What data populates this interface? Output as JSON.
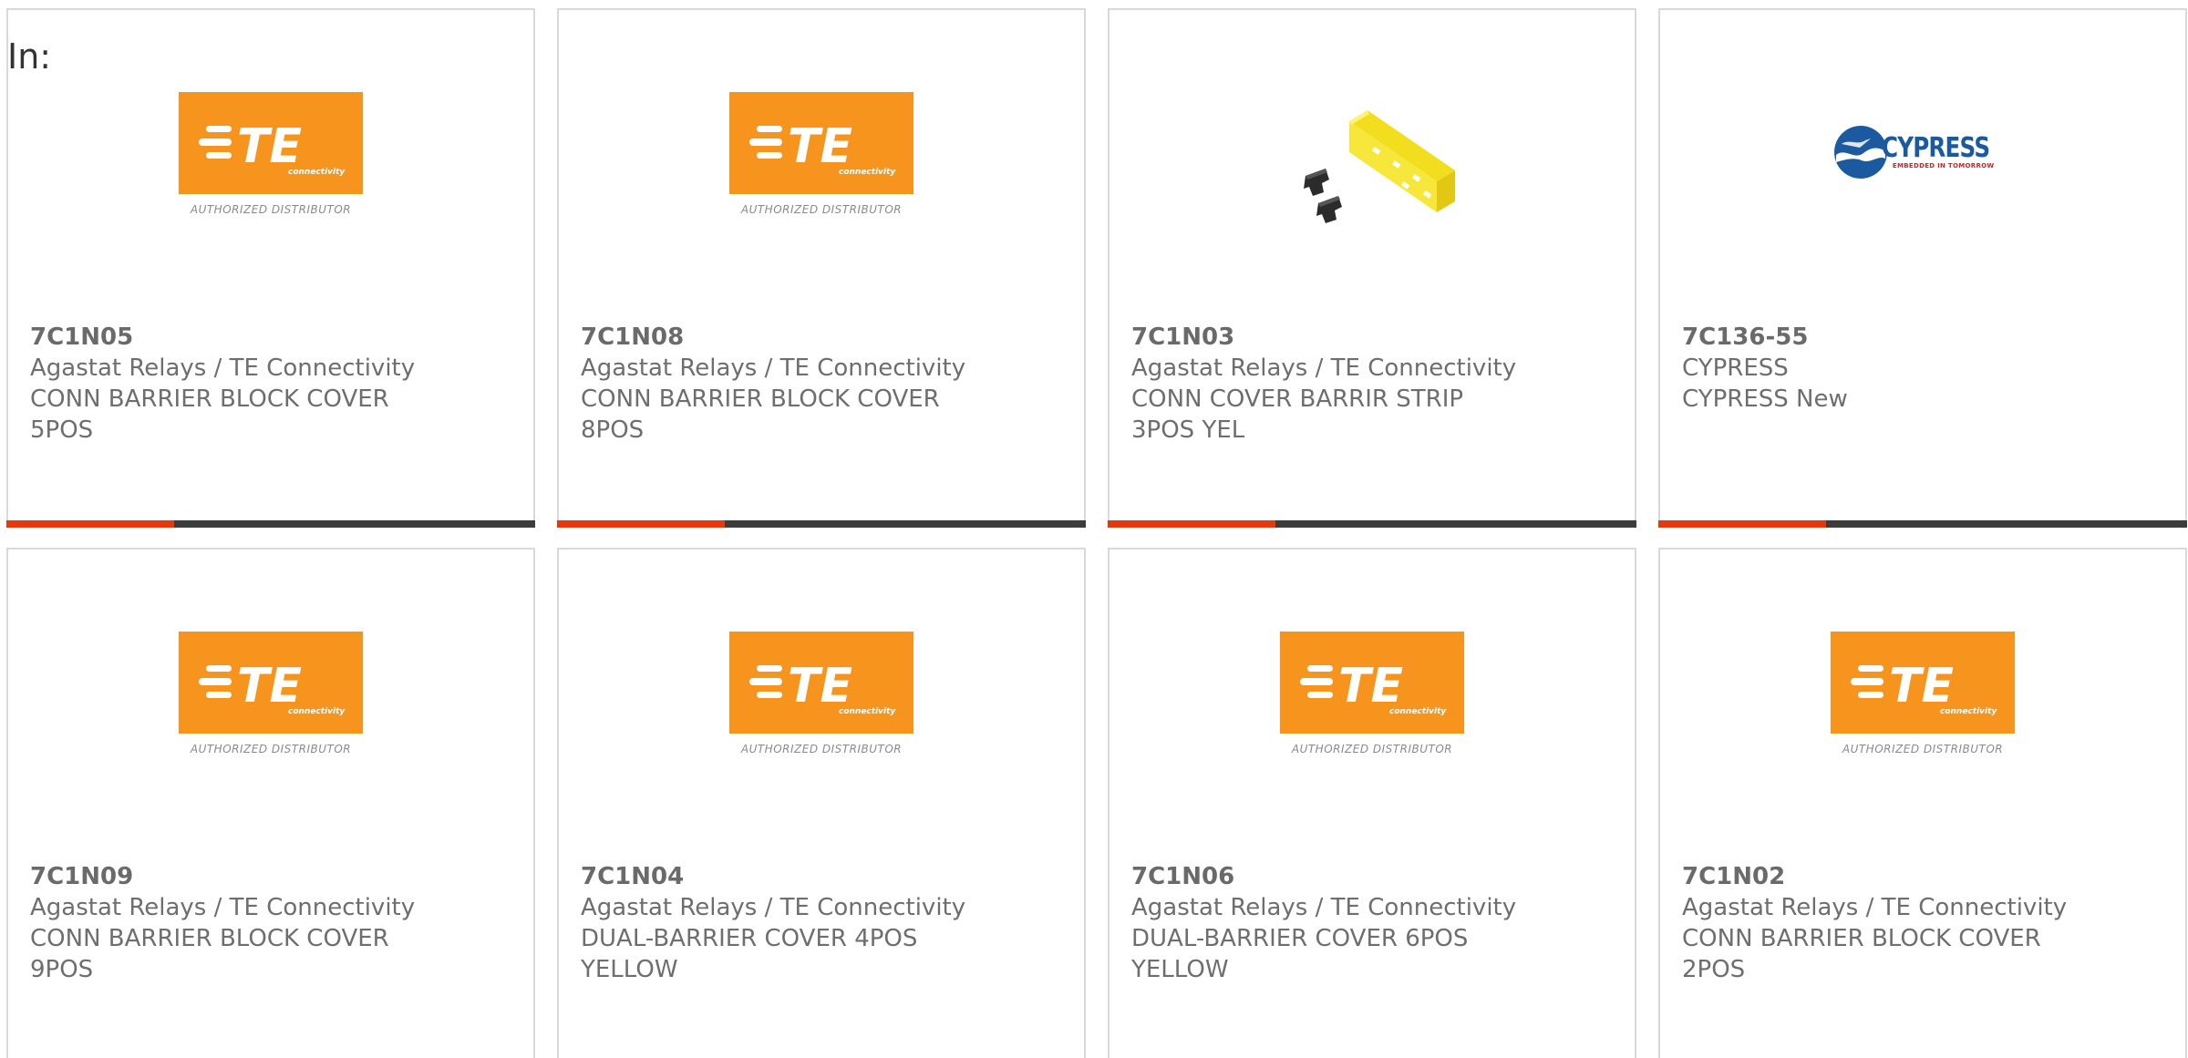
{
  "header": {
    "in_label": "In:"
  },
  "te_logo": {
    "brand_text": "TE",
    "sub_text": "connectivity",
    "tagline": "AUTHORIZED DISTRIBUTOR"
  },
  "cypress_logo": {
    "brand_text": "CYPRESS",
    "tagline": "EMBEDDED IN TOMORROW"
  },
  "colors": {
    "accent": "#e5380d",
    "bar": "#3c3c3c",
    "te_orange": "#f7941d",
    "cypress_blue": "#1b5aa0",
    "bracket_yellow": "#f6e73a"
  },
  "products": [
    {
      "part": "7C1N05",
      "manufacturer": "Agastat Relays / TE Connectivity",
      "desc1": "CONN BARRIER BLOCK COVER",
      "desc2": "5POS",
      "image": "te-logo"
    },
    {
      "part": "7C1N08",
      "manufacturer": "Agastat Relays / TE Connectivity",
      "desc1": "CONN BARRIER BLOCK COVER",
      "desc2": "8POS",
      "image": "te-logo"
    },
    {
      "part": "7C1N03",
      "manufacturer": "Agastat Relays / TE Connectivity",
      "desc1": "CONN COVER BARRIR STRIP",
      "desc2": "3POS YEL",
      "image": "yellow-barrier-cover"
    },
    {
      "part": "7C136-55",
      "manufacturer": "CYPRESS",
      "desc1": "CYPRESS New",
      "desc2": "",
      "image": "cypress-logo"
    },
    {
      "part": "7C1N09",
      "manufacturer": "Agastat Relays / TE Connectivity",
      "desc1": "CONN BARRIER BLOCK COVER",
      "desc2": "9POS",
      "image": "te-logo"
    },
    {
      "part": "7C1N04",
      "manufacturer": "Agastat Relays / TE Connectivity",
      "desc1": "DUAL-BARRIER COVER 4POS",
      "desc2": "YELLOW",
      "image": "te-logo"
    },
    {
      "part": "7C1N06",
      "manufacturer": "Agastat Relays / TE Connectivity",
      "desc1": "DUAL-BARRIER COVER 6POS",
      "desc2": "YELLOW",
      "image": "te-logo"
    },
    {
      "part": "7C1N02",
      "manufacturer": "Agastat Relays / TE Connectivity",
      "desc1": "CONN BARRIER BLOCK COVER",
      "desc2": "2POS",
      "image": "te-logo"
    }
  ]
}
